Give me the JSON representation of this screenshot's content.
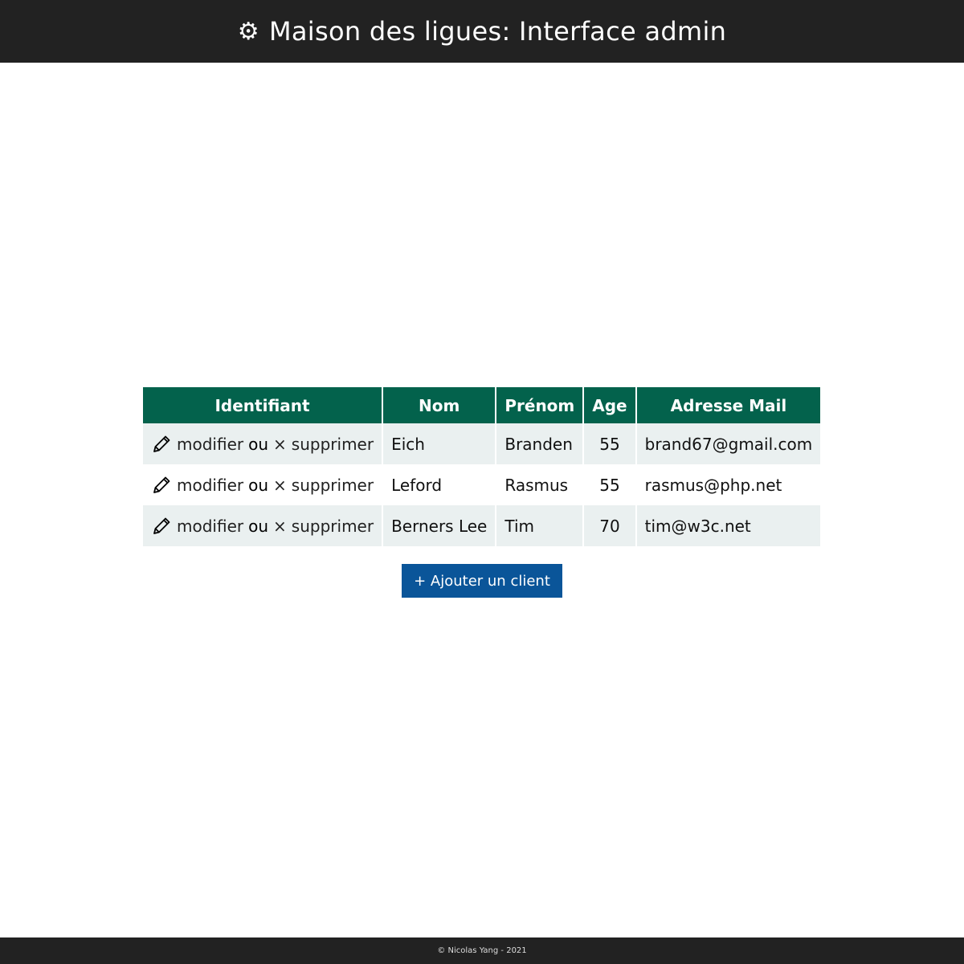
{
  "header": {
    "icon": "gear-icon",
    "icon_glyph": "⚙",
    "title": "Maison des ligues: Interface admin"
  },
  "table": {
    "columns": [
      "Identifiant",
      "Nom",
      "Prénom",
      "Age",
      "Adresse Mail"
    ],
    "action_labels": {
      "edit": "modifier",
      "separator": "ou",
      "delete_glyph": "×",
      "delete": "supprimer"
    },
    "rows": [
      {
        "nom": "Eich",
        "prenom": "Branden",
        "age": "55",
        "mail": "brand67@gmail.com"
      },
      {
        "nom": "Leford",
        "prenom": "Rasmus",
        "age": "55",
        "mail": "rasmus@php.net"
      },
      {
        "nom": "Berners Lee",
        "prenom": "Tim",
        "age": "70",
        "mail": "tim@w3c.net"
      }
    ]
  },
  "add_button": {
    "label": "+ Ajouter un client"
  },
  "footer": {
    "text": "© Nicolas Yang - 2021"
  },
  "colors": {
    "topbar": "#222222",
    "table_header": "#03624c",
    "row_stripe": "#eaf0f0",
    "button": "#0a5599"
  }
}
